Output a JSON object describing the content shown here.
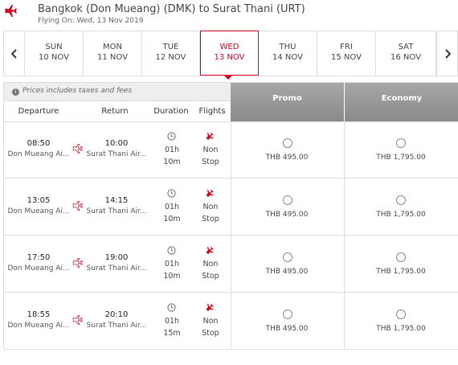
{
  "header": {
    "title": "Bangkok (Don Mueang) (DMK) to Surat Thani (URT)",
    "subtitle": "Flying On: Wed, 13 Nov 2019"
  },
  "dates": [
    {
      "dow": "SUN",
      "date": "10 NOV",
      "selected": false
    },
    {
      "dow": "MON",
      "date": "11 NOV",
      "selected": false
    },
    {
      "dow": "TUE",
      "date": "12 NOV",
      "selected": false
    },
    {
      "dow": "WED",
      "date": "13 NOV",
      "selected": true
    },
    {
      "dow": "THU",
      "date": "14 NOV",
      "selected": false
    },
    {
      "dow": "FRI",
      "date": "15 NOV",
      "selected": false
    },
    {
      "dow": "SAT",
      "date": "16 NOV",
      "selected": false
    }
  ],
  "table": {
    "note": "Prices includes taxes and fees",
    "headers": {
      "departure": "Departure",
      "return": "Return",
      "duration": "Duration",
      "flights": "Flights"
    },
    "fares": [
      "Promo",
      "Economy"
    ]
  },
  "flights": [
    {
      "dep_time": "08:50",
      "dep_airport": "Don Mueang Ai...",
      "arr_time": "10:00",
      "arr_airport": "Surat Thani Air...",
      "dur_h": "01h",
      "dur_m": "10m",
      "stop1": "Non",
      "stop2": "Stop",
      "promo": "THB 495.00",
      "economy": "THB 1,795.00"
    },
    {
      "dep_time": "13:05",
      "dep_airport": "Don Mueang Ai...",
      "arr_time": "14:15",
      "arr_airport": "Surat Thani Air...",
      "dur_h": "01h",
      "dur_m": "10m",
      "stop1": "Non",
      "stop2": "Stop",
      "promo": "THB 495.00",
      "economy": "THB 1,795.00"
    },
    {
      "dep_time": "17:50",
      "dep_airport": "Don Mueang Ai...",
      "arr_time": "19:00",
      "arr_airport": "Surat Thani Air...",
      "dur_h": "01h",
      "dur_m": "10m",
      "stop1": "Non",
      "stop2": "Stop",
      "promo": "THB 495.00",
      "economy": "THB 1,795.00"
    },
    {
      "dep_time": "18:55",
      "dep_airport": "Don Mueang Ai...",
      "arr_time": "20:10",
      "arr_airport": "Surat Thani Air...",
      "dur_h": "01h",
      "dur_m": "15m",
      "stop1": "Non",
      "stop2": "Stop",
      "promo": "THB 495.00",
      "economy": "THB 1,795.00"
    }
  ],
  "colors": {
    "accent": "#d0021b",
    "fare_header": "#9b9b9b",
    "border": "#dddddd"
  },
  "icons": {
    "header": "plane-icon",
    "prev": "chevron-left-icon",
    "next": "chevron-right-icon",
    "info": "info-icon",
    "route": "plane-icon",
    "duration": "clock-icon",
    "flight": "plane-icon"
  }
}
